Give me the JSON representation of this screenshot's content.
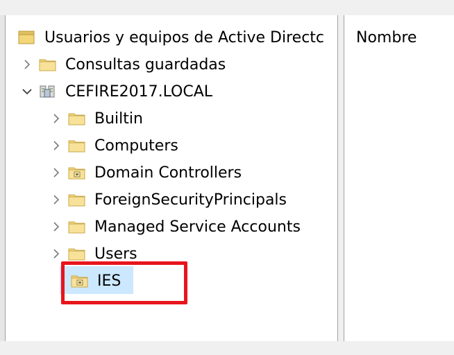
{
  "tree": {
    "root": {
      "label": "Usuarios y equipos de Active Directc",
      "icon": "aduc-console-icon"
    },
    "items": [
      {
        "label": "Consultas guardadas",
        "icon": "folder-icon",
        "expander": "collapsed"
      },
      {
        "label": "CEFIRE2017.LOCAL",
        "icon": "domain-icon",
        "expander": "expanded"
      },
      {
        "label": "Builtin",
        "icon": "folder-icon",
        "expander": "collapsed"
      },
      {
        "label": "Computers",
        "icon": "folder-icon",
        "expander": "collapsed"
      },
      {
        "label": "Domain Controllers",
        "icon": "ou-folder-icon",
        "expander": "collapsed"
      },
      {
        "label": "ForeignSecurityPrincipals",
        "icon": "folder-icon",
        "expander": "collapsed"
      },
      {
        "label": "Managed Service Accounts",
        "icon": "folder-icon",
        "expander": "collapsed"
      },
      {
        "label": "Users",
        "icon": "folder-icon",
        "expander": "collapsed"
      },
      {
        "label": "IES",
        "icon": "ou-folder-icon",
        "expander": "none",
        "selected": true
      }
    ]
  },
  "details": {
    "columns": [
      "Nombre"
    ]
  },
  "colors": {
    "selection": "#cce8ff",
    "annotation": "#e8141c",
    "folder": "#f3d57a"
  }
}
